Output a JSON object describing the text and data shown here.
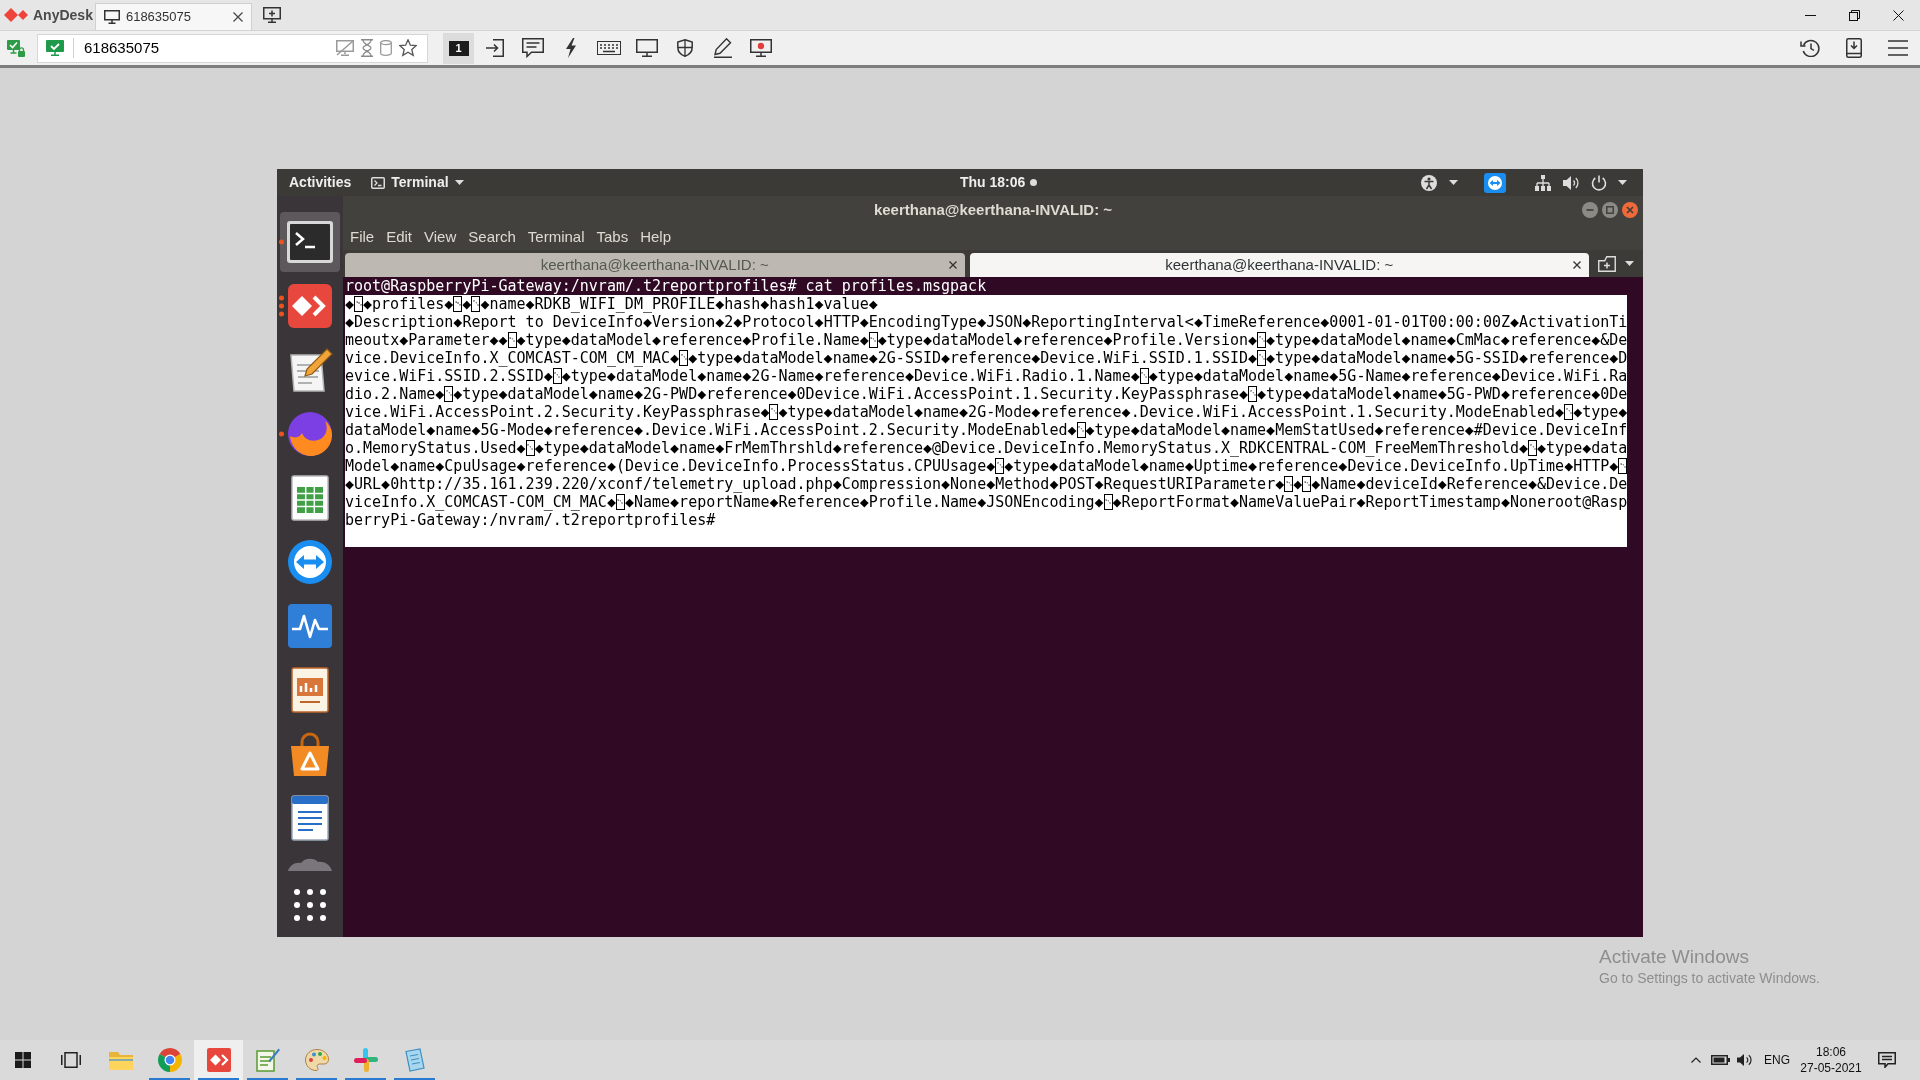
{
  "anydesk": {
    "app_name": "AnyDesk",
    "tabs": [
      {
        "label": "618635075",
        "selected": true
      }
    ],
    "address": "618635075",
    "display_button": "1"
  },
  "ubuntu": {
    "top_bar": {
      "activities": "Activities",
      "app_menu": "Terminal",
      "clock": "Thu 18:06",
      "notification": true
    },
    "dock": {
      "items": [
        {
          "kind": "terminal",
          "selected": true,
          "running": true,
          "multiple_windows": false
        },
        {
          "kind": "diamond",
          "selected": false,
          "running": true,
          "multiple_windows": true
        },
        {
          "kind": "notepad",
          "selected": false,
          "running": false
        },
        {
          "kind": "foxglobe",
          "selected": false,
          "running": true,
          "multiple_windows": false
        },
        {
          "kind": "spreadsheet",
          "selected": false,
          "running": false
        },
        {
          "kind": "arrows",
          "selected": false,
          "running": false
        },
        {
          "kind": "waveform",
          "selected": false,
          "running": false
        },
        {
          "kind": "slides",
          "selected": false,
          "running": false
        },
        {
          "kind": "bag",
          "selected": false,
          "running": false
        },
        {
          "kind": "document",
          "selected": false,
          "running": false
        },
        {
          "kind": "faded",
          "selected": false,
          "running": false
        },
        {
          "kind": "grid",
          "selected": false,
          "running": false
        }
      ]
    },
    "terminal": {
      "title": "keerthana@keerthana-INVALID: ~",
      "menu": [
        "File",
        "Edit",
        "View",
        "Search",
        "Terminal",
        "Tabs",
        "Help"
      ],
      "tabs": [
        {
          "label": "keerthana@keerthana-INVALID: ~",
          "selected": false
        },
        {
          "label": "keerthana@keerthana-INVALID: ~",
          "selected": true
        }
      ],
      "prompt": "root@RaspberryPi-Gateway:/nvram/.t2reportprofiles# cat profiles.msgpack",
      "output": {
        "highlighted": true,
        "lines": [
          "◆␁◆profiles◆␁◆␃◆name◆RDKB_WIFI_DM_PROFILE◆hash◆hash1◆value◆",
          "◆Description◆Report to DeviceInfo◆Version◆2◆Protocol◆HTTP◆EncodingType◆JSON◆ReportingInterval<◆TimeReference◆0001-01-01T00:00:00Z◆ActivationTi",
          "meoutx◆Parameter◆◆␂◆type◆dataModel◆reference◆Profile.Name◆␂◆type◆dataModel◆reference◆Profile.Version◆␃◆type◆dataModel◆name◆CmMac◆reference◆&De",
          "vice.DeviceInfo.X_COMCAST-COM_CM_MAC◆␃◆type◆dataModel◆name◆2G-SSID◆reference◆Device.WiFi.SSID.1.SSID◆␃◆type◆dataModel◆name◆5G-SSID◆reference◆D",
          "evice.WiFi.SSID.2.SSID◆␃◆type◆dataModel◆name◆2G-Name◆reference◆Device.WiFi.Radio.1.Name◆␃◆type◆dataModel◆name◆5G-Name◆reference◆Device.WiFi.Ra",
          "dio.2.Name◆␃◆type◆dataModel◆name◆2G-PWD◆reference◆0Device.WiFi.AccessPoint.1.Security.KeyPassphrase◆␃◆type◆dataModel◆name◆5G-PWD◆reference◆0De",
          "vice.WiFi.AccessPoint.2.Security.KeyPassphrase◆␃◆type◆dataModel◆name◆2G-Mode◆reference◆.Device.WiFi.AccessPoint.1.Security.ModeEnabled◆␃◆type◆",
          "dataModel◆name◆5G-Mode◆reference◆.Device.WiFi.AccessPoint.2.Security.ModeEnabled◆␃◆type◆dataModel◆name◆MemStatUsed◆reference◆#Device.DeviceInf",
          "o.MemoryStatus.Used◆␃◆type◆dataModel◆name◆FrMemThrshld◆reference◆@Device.DeviceInfo.MemoryStatus.X_RDKCENTRAL-COM_FreeMemThreshold◆␃◆type◆data",
          "Model◆name◆CpuUsage◆reference◆(Device.DeviceInfo.ProcessStatus.CPUUsage◆␃◆type◆dataModel◆name◆Uptime◆reference◆Device.DeviceInfo.UpTime◆HTTP◆␂",
          "◆URL◆0http://35.161.239.220/xconf/telemetry_upload.php◆Compression◆None◆Method◆POST◆RequestURIParameter◆␂◆␂◆Name◆deviceId◆Reference◆&Device.De",
          "viceInfo.X_COMCAST-COM_CM_MAC◆␂◆Name◆reportName◆Reference◆Profile.Name◆JSONEncoding◆␂◆ReportFormat◆NameValuePair◆ReportTimestamp◆Noneroot@Rasp",
          "berryPi-Gateway:/nvram/.t2reportprofiles#"
        ]
      }
    }
  },
  "windows": {
    "taskbar": {
      "items": [
        {
          "kind": "start",
          "running": false,
          "active": false
        },
        {
          "kind": "taskview",
          "running": false,
          "active": false
        },
        {
          "kind": "folder",
          "running": false,
          "active": false
        },
        {
          "kind": "ringlogo",
          "running": true,
          "active": false
        },
        {
          "kind": "diamond",
          "running": true,
          "active": true
        },
        {
          "kind": "notepad",
          "running": true,
          "active": false
        },
        {
          "kind": "palette",
          "running": true,
          "active": false
        },
        {
          "kind": "pinwheel",
          "running": true,
          "active": false
        },
        {
          "kind": "sheet",
          "running": true,
          "active": false
        }
      ],
      "language": "ENG",
      "time": "18:06",
      "date": "27-05-2021"
    },
    "activation": {
      "title": "Activate Windows",
      "hint": "Go to Settings to activate Windows."
    }
  }
}
